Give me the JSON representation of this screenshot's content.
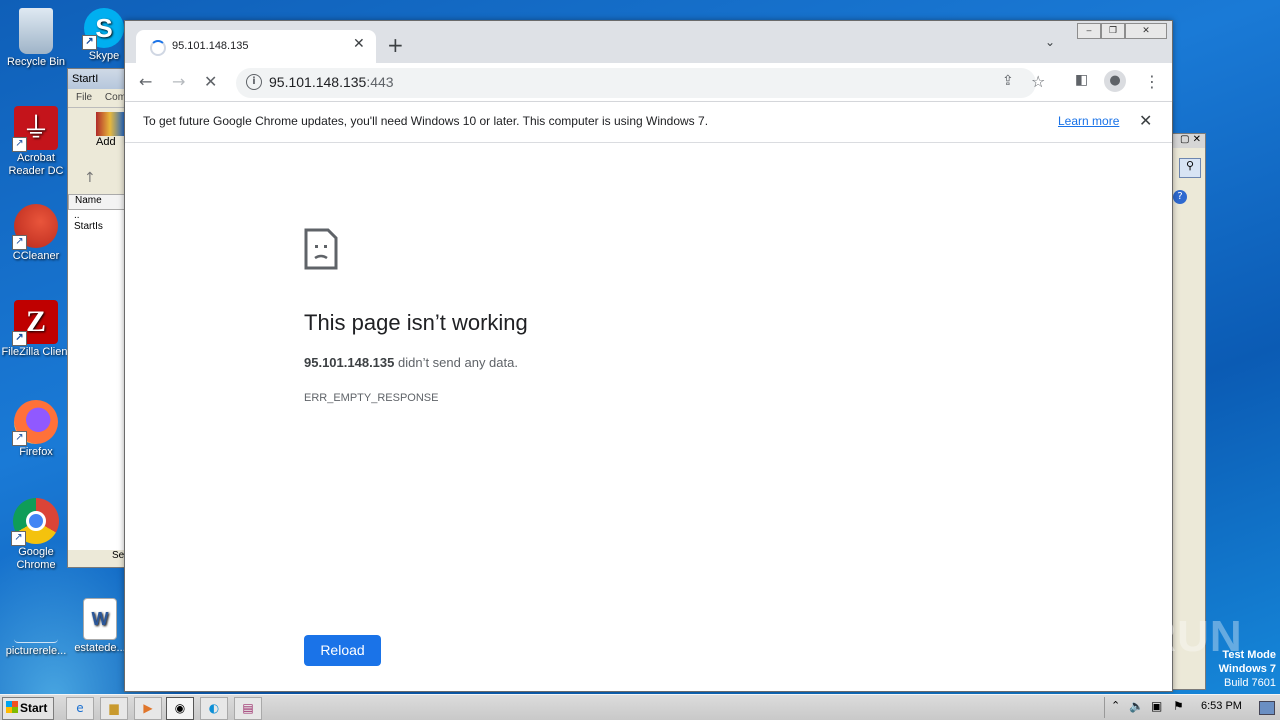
{
  "desktop": {
    "icons": [
      {
        "label": "Recycle Bin"
      },
      {
        "label": "Skype"
      },
      {
        "label": "Acrobat Reader DC"
      },
      {
        "label": "CCleaner"
      },
      {
        "label": "FileZilla Client"
      },
      {
        "label": "Firefox"
      },
      {
        "label": "Google Chrome"
      },
      {
        "label": "picturerele..."
      },
      {
        "label": "estatede..."
      }
    ],
    "watermark": "ANY RUN",
    "test_mode": [
      "Test Mode",
      "Windows 7",
      "Build 7601"
    ]
  },
  "winrar": {
    "title": "StartI",
    "menu": [
      "File",
      "Com"
    ],
    "add_label": "Add",
    "column": "Name",
    "rows": [
      "..",
      "StartIs"
    ],
    "status": "Se"
  },
  "chrome": {
    "tab_title": "95.101.148.135",
    "url_host": "95.101.148.135",
    "url_port": ":443",
    "infobar": {
      "message": "To get future Google Chrome updates, you'll need Windows 10 or later. This computer is using Windows 7.",
      "link": "Learn more"
    },
    "error": {
      "title": "This page isn’t working",
      "host": "95.101.148.135",
      "desc_suffix": " didn’t send any data.",
      "code": "ERR_EMPTY_RESPONSE",
      "reload_label": "Reload"
    }
  },
  "taskbar": {
    "start_label": "Start",
    "clock": "6:53 PM"
  },
  "colors": {
    "accent": "#1a73e8",
    "desktop": "#1a7ad6"
  }
}
